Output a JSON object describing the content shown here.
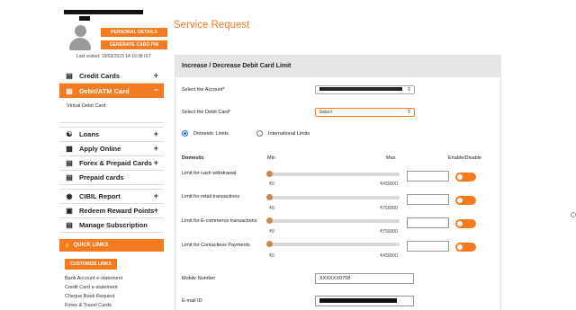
{
  "profile": {
    "personal_details_label": "PERSONAL DETAILS",
    "generate_pin_label": "GENERATE CARD PIN",
    "last_visited": "Last visited: 19/03/2023 14:10:38 IST"
  },
  "nav": {
    "items": [
      {
        "label": "Credit Cards",
        "icon": "credit-card-icon"
      },
      {
        "label": "Debit/ATM Card",
        "icon": "debit-card-icon"
      },
      {
        "label": "Loans",
        "icon": "handshake-icon"
      },
      {
        "label": "Apply Online",
        "icon": "laptop-icon"
      },
      {
        "label": "Forex & Prepaid Cards",
        "icon": "forex-card-icon"
      },
      {
        "label": "Prepaid cards",
        "icon": "prepaid-card-icon"
      },
      {
        "label": "CIBIL Report",
        "icon": "cibil-icon"
      },
      {
        "label": "Redeem Reward Points",
        "icon": "gift-icon"
      },
      {
        "label": "Manage Subscription",
        "icon": "subscription-icon"
      }
    ],
    "sub_item": "Virtual Debit Card",
    "quick_links_title": "QUICK LINKS",
    "customize_links_label": "CUSTOMIZE LINKS",
    "quick_links": [
      "Bank Account e-statement",
      "Credit Card e-statement",
      "Cheque Book Request",
      "Forex & Travel Cards"
    ]
  },
  "main": {
    "page_title": "Service Request",
    "panel_title": "Increase / Decrease Debit Card Limit",
    "select_account_label": "Select the Account*",
    "select_card_label": "Select the Debit Card*",
    "select_card_value": "Select",
    "domestic_limits_label": "Domestic Limits",
    "international_limits_label": "International Limits",
    "selected_limit_type": "Domestic Limits",
    "columns": {
      "type": "Domestic",
      "min": "Min",
      "max": "Max",
      "toggle": "Enable/Disable"
    },
    "limits": [
      {
        "label": "Limit for cash withdrawal",
        "min": "₹0",
        "max": "₹450000",
        "slider_value": 0,
        "enabled": true
      },
      {
        "label": "Limit for retail transactions",
        "min": "₹0",
        "max": "₹750000",
        "slider_value": 0,
        "enabled": true
      },
      {
        "label": "Limit for E-commerce transactions",
        "min": "₹0",
        "max": "₹750000",
        "slider_value": 0,
        "enabled": true
      },
      {
        "label": "Limit for Contactless Payments",
        "min": "₹0",
        "max": "₹450000",
        "slider_value": 0,
        "enabled": true
      }
    ],
    "mobile_label": "Mobile Number",
    "mobile_value": "XXXXXX0758",
    "email_label": "E-mail ID"
  },
  "colors": {
    "accent": "#f47b20",
    "panel_header": "#e6e6e6",
    "radio": "#1a73e8"
  }
}
